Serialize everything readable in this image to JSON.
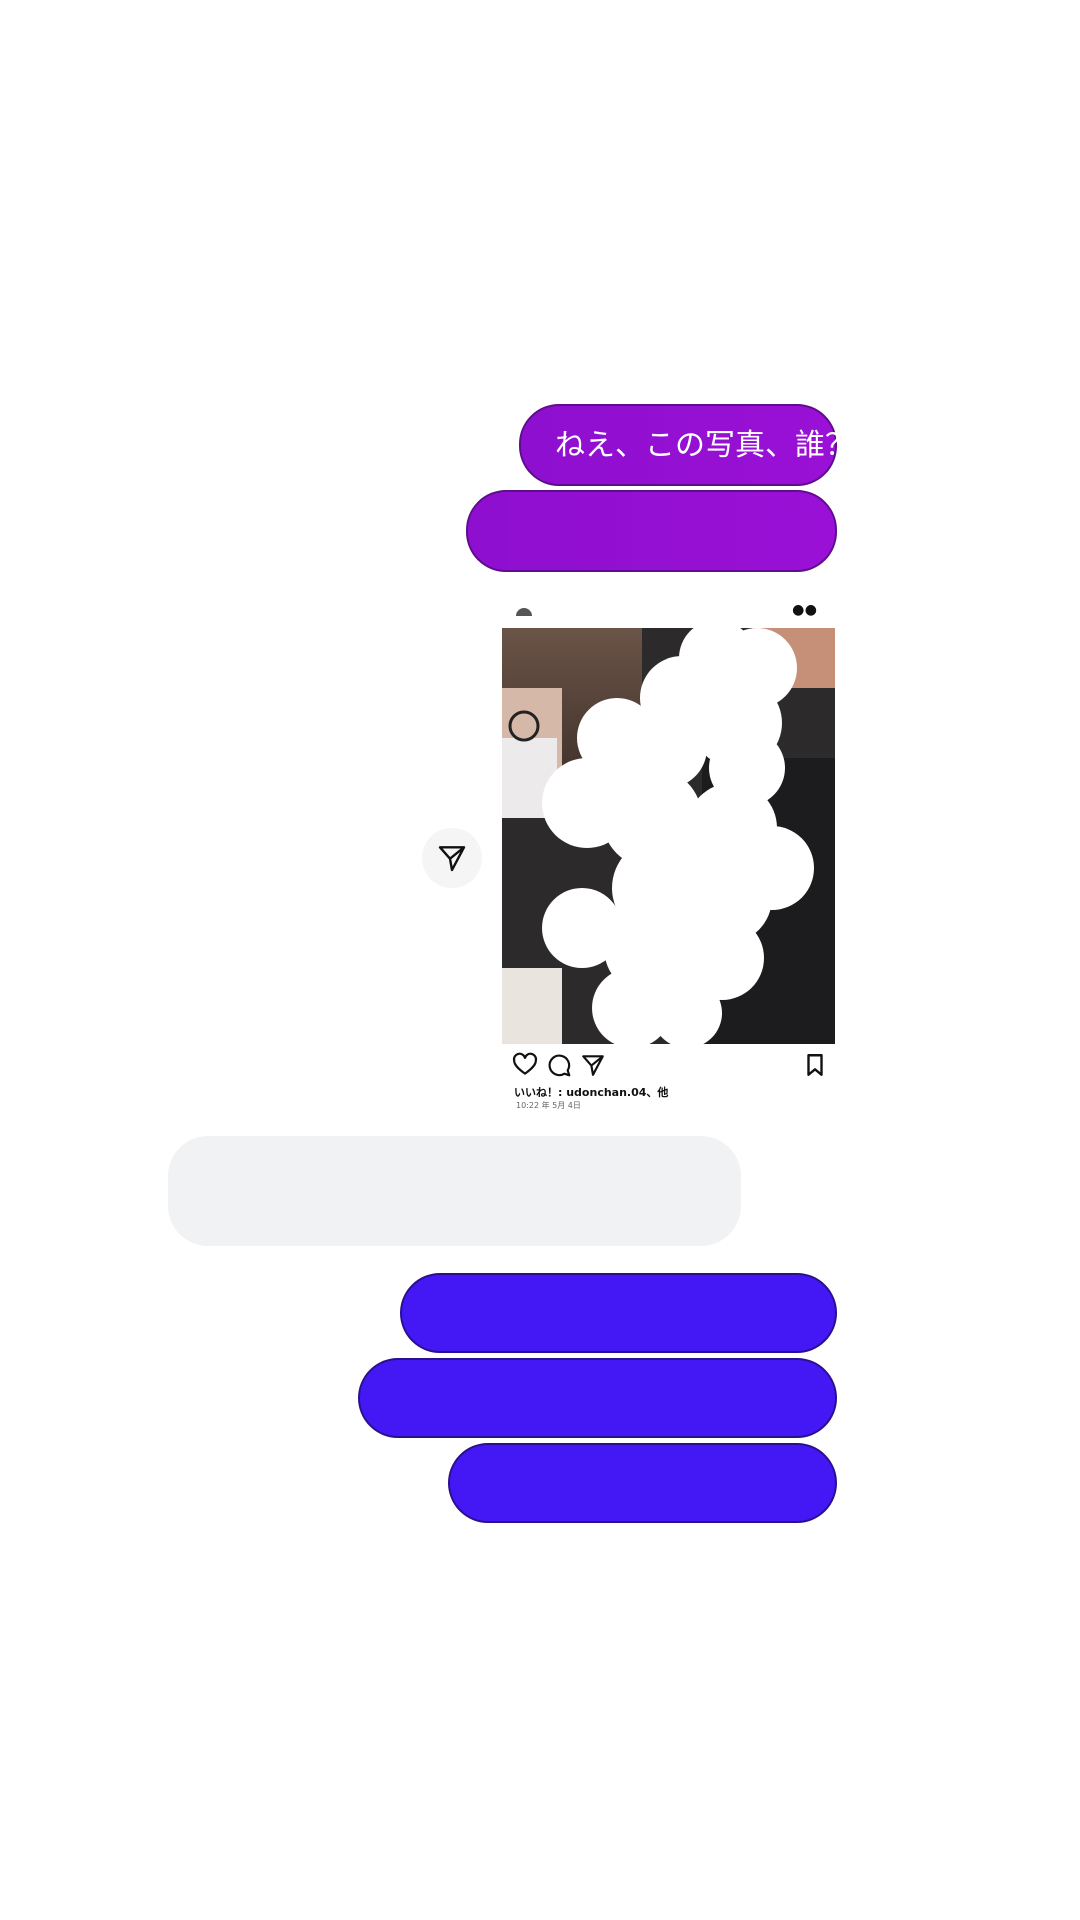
{
  "messages": {
    "m1": "ねえ、この写真、誰？",
    "m2": "",
    "m3": "",
    "m4": "",
    "m5": "",
    "m6": ""
  },
  "post": {
    "likes_text": "いいね！: udonchan.04、他",
    "date_text": "10:22 年 5月 4日"
  },
  "icons": {
    "share": "send-icon",
    "like": "heart-icon",
    "comment": "comment-icon",
    "send": "send-icon",
    "save": "bookmark-icon",
    "more": "more-icon"
  },
  "colors": {
    "sent_purple": "#9410d4",
    "sent_violet": "#4318f5",
    "received_gray": "#f1f2f4",
    "background": "#ffffff"
  }
}
